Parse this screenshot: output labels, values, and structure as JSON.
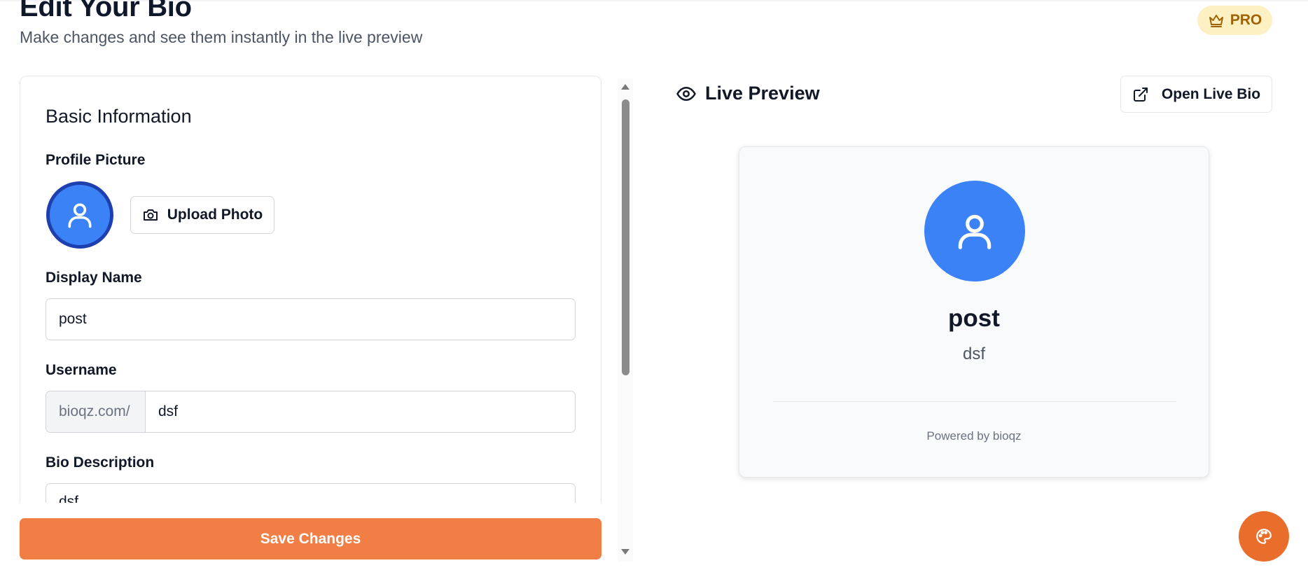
{
  "header": {
    "title": "Edit Your Bio",
    "subtitle": "Make changes and see them instantly in the live preview",
    "badge": "PRO",
    "badge_icon": "crown-icon"
  },
  "editor": {
    "section_title": "Basic Information",
    "profile_picture_label": "Profile Picture",
    "upload_button_label": "Upload Photo",
    "display_name_label": "Display Name",
    "display_name_value": "post",
    "username_label": "Username",
    "username_prefix": "bioqz.com/",
    "username_value": "dsf",
    "bio_label": "Bio Description",
    "bio_value": "dsf",
    "save_button_label": "Save Changes"
  },
  "preview": {
    "heading": "Live Preview",
    "open_button_label": "Open Live Bio",
    "name": "post",
    "username": "dsf",
    "powered_by": "Powered by bioqz"
  },
  "colors": {
    "accent": "#f07e45",
    "avatar": "#3b82f6",
    "avatar_ring": "#1e40af",
    "badge_bg": "#fdf0c2",
    "badge_text": "#a16207",
    "fab": "#ea6e2b"
  }
}
